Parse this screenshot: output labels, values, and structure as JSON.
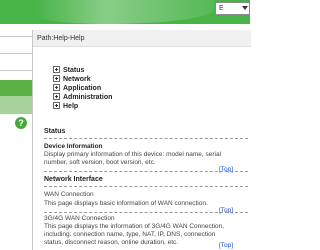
{
  "header": {
    "language": "E"
  },
  "left_menu": {
    "help_badge": "?"
  },
  "path": "Path:Help-Help",
  "tree": [
    "Status",
    "Network",
    "Application",
    "Administration",
    "Help"
  ],
  "status_section": {
    "title": "Status",
    "device_info": {
      "heading": "Device Information",
      "desc_line1": "Display primary information of this device: model name, serial",
      "desc_line2": "number, soft version, boot version, etc.",
      "top_link": "[Top]"
    }
  },
  "network_interface": {
    "title": "Network Interface",
    "wan": {
      "heading": "WAN Connection",
      "desc": "This page displays basic information of WAN connection.",
      "top_link": "[Top]"
    },
    "wan_3g4g": {
      "heading": "3G/4G WAN Connection",
      "desc_line1": "This page displays the information of 3G/4G WAN Connection,",
      "desc_line2": "including: connection name, type, NAT, IP, DNS, connection",
      "desc_line3": "status, disconnect reason, online duration, etc.",
      "top_link": "[Top]"
    }
  },
  "colors": {
    "banner": "#48b347",
    "menu_active": "#5bb046",
    "menu_light": "#a6d39b",
    "link": "#1f4fc6"
  }
}
